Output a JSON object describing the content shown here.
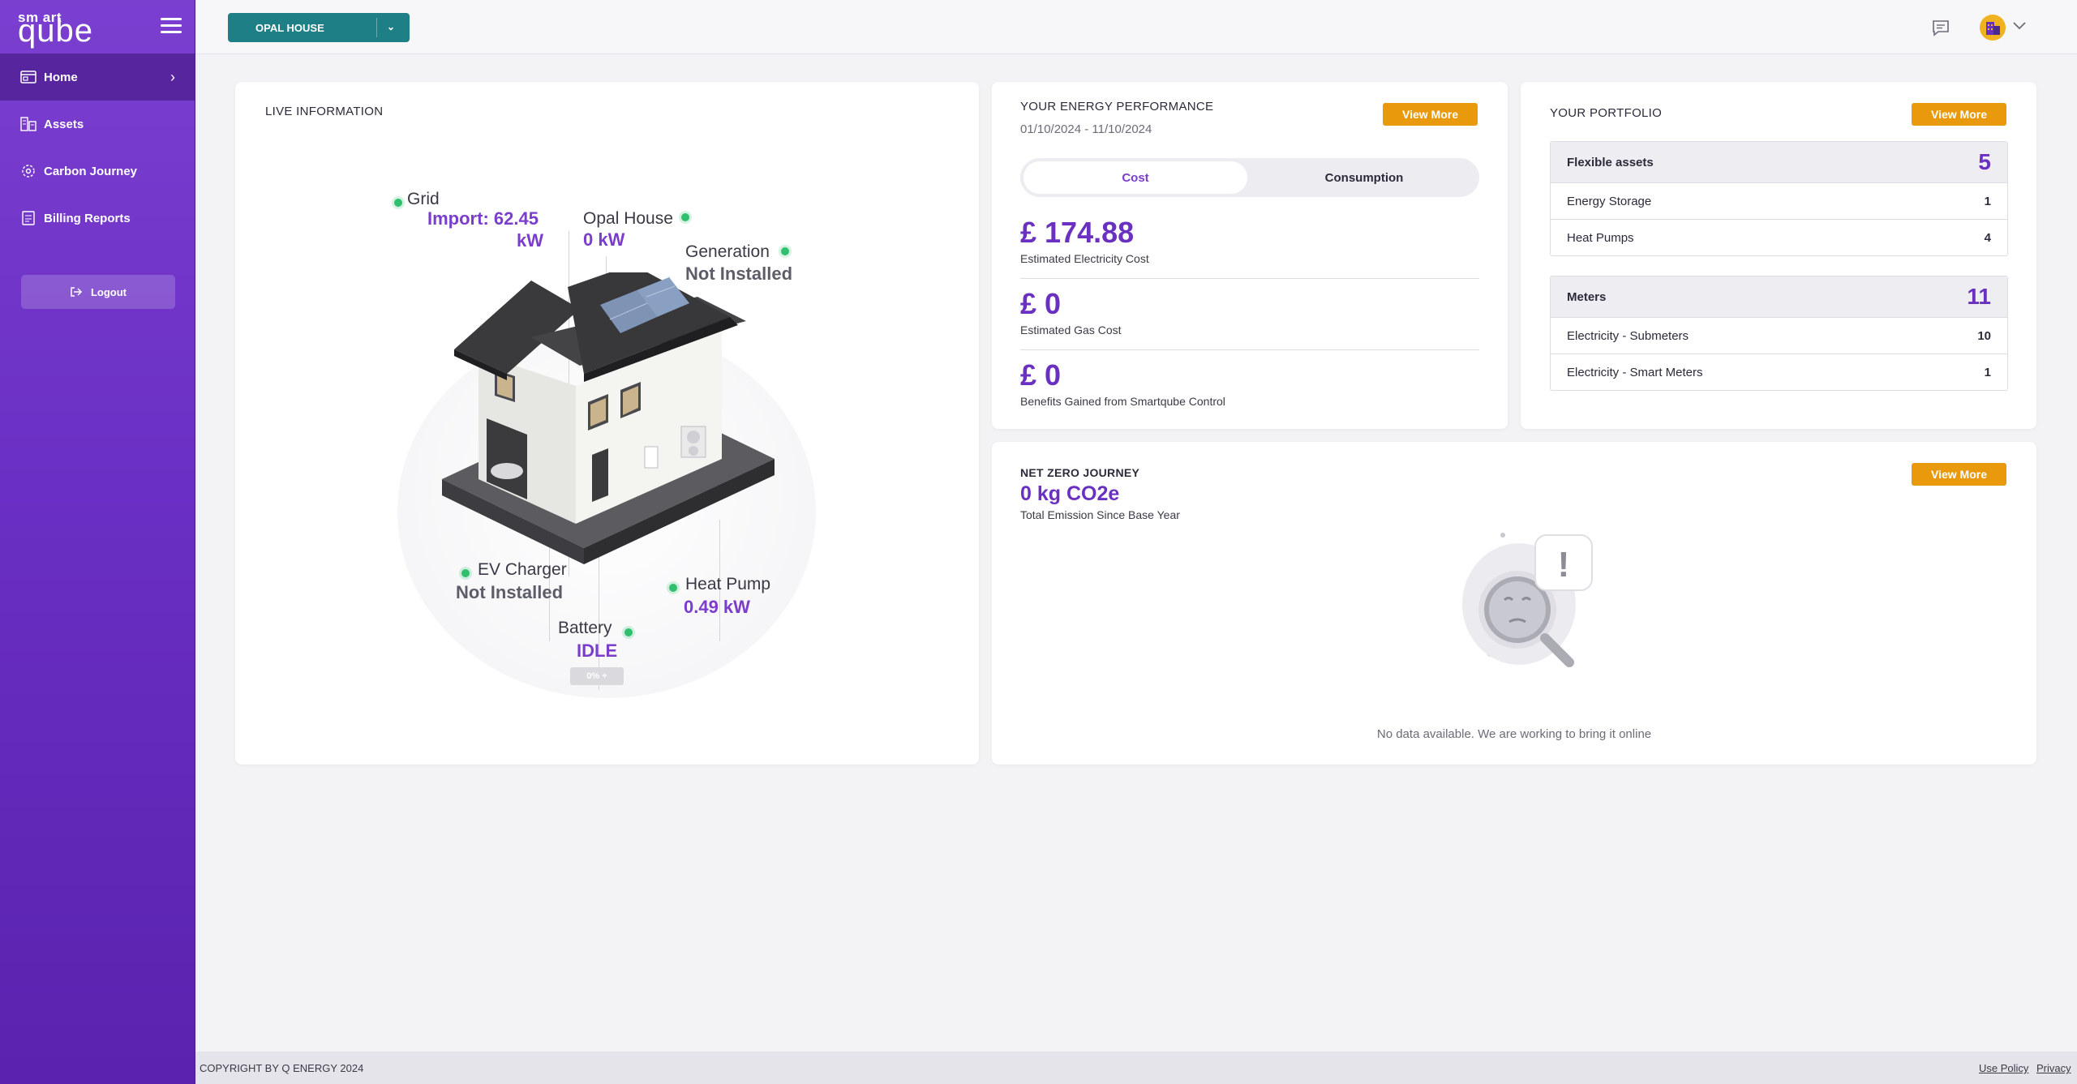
{
  "brand": {
    "logo_small": "sm art",
    "logo_big": "qube"
  },
  "sidebar": {
    "items": [
      {
        "label": "Home",
        "icon": "home-icon",
        "active": true
      },
      {
        "label": "Assets",
        "icon": "assets-icon"
      },
      {
        "label": "Carbon Journey",
        "icon": "carbon-journey-icon"
      },
      {
        "label": "Billing Reports",
        "icon": "billing-reports-icon"
      }
    ],
    "logout_label": "Logout"
  },
  "header": {
    "site_name": "OPAL HOUSE"
  },
  "live": {
    "title": "LIVE INFORMATION",
    "grid": {
      "label": "Grid",
      "value_line1": "Import: 62.45",
      "value_line2": "kW"
    },
    "house": {
      "label": "Opal House",
      "value": "0 kW"
    },
    "generation": {
      "label": "Generation",
      "value": "Not Installed"
    },
    "ev": {
      "label": "EV Charger",
      "value": "Not Installed"
    },
    "heatpump": {
      "label": "Heat Pump",
      "value": "0.49 kW"
    },
    "battery": {
      "label": "Battery",
      "value": "IDLE",
      "level": "0% +"
    }
  },
  "energy": {
    "title": "YOUR ENERGY PERFORMANCE",
    "date_range": "01/10/2024 - 11/10/2024",
    "view_more": "View More",
    "tabs": [
      "Cost",
      "Consumption"
    ],
    "metrics": [
      {
        "amount": "£ 174.88",
        "label": "Estimated Electricity Cost"
      },
      {
        "amount": "£ 0",
        "label": "Estimated Gas Cost"
      },
      {
        "amount": "£ 0",
        "label": "Benefits Gained from Smartqube Control"
      }
    ]
  },
  "portfolio": {
    "title": "YOUR PORTFOLIO",
    "view_more": "View More",
    "flexible": {
      "label": "Flexible assets",
      "total": "5",
      "rows": [
        {
          "label": "Energy Storage",
          "count": "1"
        },
        {
          "label": "Heat Pumps",
          "count": "4"
        }
      ]
    },
    "meters": {
      "label": "Meters",
      "total": "11",
      "rows": [
        {
          "label": "Electricity - Submeters",
          "count": "10"
        },
        {
          "label": "Electricity - Smart Meters",
          "count": "1"
        }
      ]
    }
  },
  "netzero": {
    "title": "NET ZERO JOURNEY",
    "view_more": "View More",
    "value": "0 kg CO2e",
    "subtitle": "Total Emission Since Base Year",
    "empty_text": "No data available. We are working to bring it online"
  },
  "footer": {
    "copyright": "COPYRIGHT BY Q ENERGY 2024",
    "use_policy": "Use Policy",
    "privacy": "Privacy"
  },
  "colors": {
    "primary": "#6a30c0",
    "accent": "#e89a0c",
    "teal": "#1f7f86",
    "status_green": "#2fbf6e"
  }
}
